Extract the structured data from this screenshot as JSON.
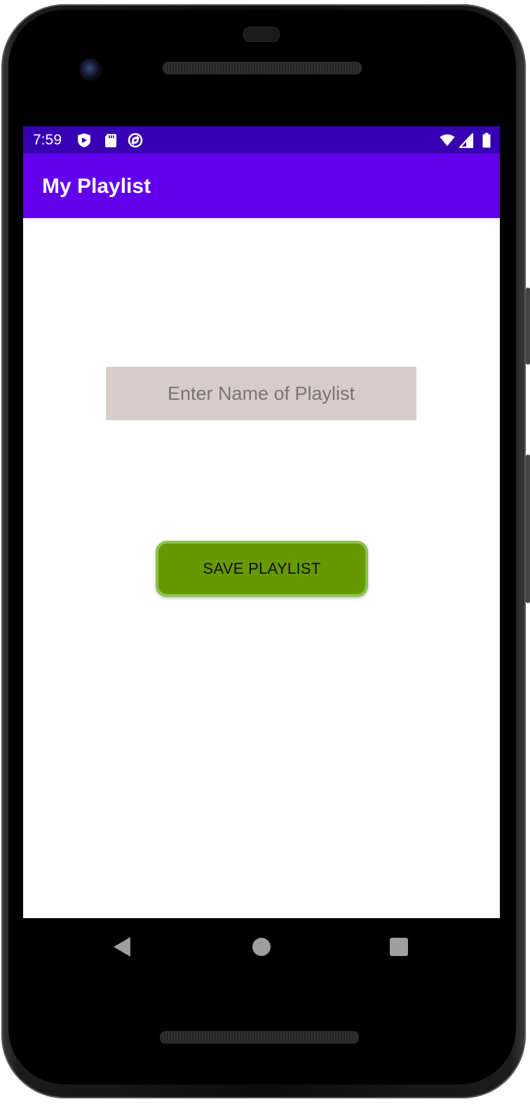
{
  "status_bar": {
    "time": "7:59",
    "left_icons": [
      "shield-icon",
      "sd-card-icon",
      "sync-icon"
    ],
    "right_icons": [
      "wifi-icon",
      "signal-icon",
      "battery-icon"
    ],
    "background": "#3700b3"
  },
  "app_bar": {
    "title": "My Playlist",
    "background": "#6200ee"
  },
  "form": {
    "playlist_name_value": "",
    "playlist_name_placeholder": "Enter Name of Playlist",
    "input_background": "#d7ccc8",
    "save_label": "SAVE PLAYLIST",
    "save_background": "#669900",
    "save_border": "#8bc34a"
  },
  "nav_bar": {
    "buttons": [
      "back-icon",
      "home-icon",
      "recents-icon"
    ]
  }
}
